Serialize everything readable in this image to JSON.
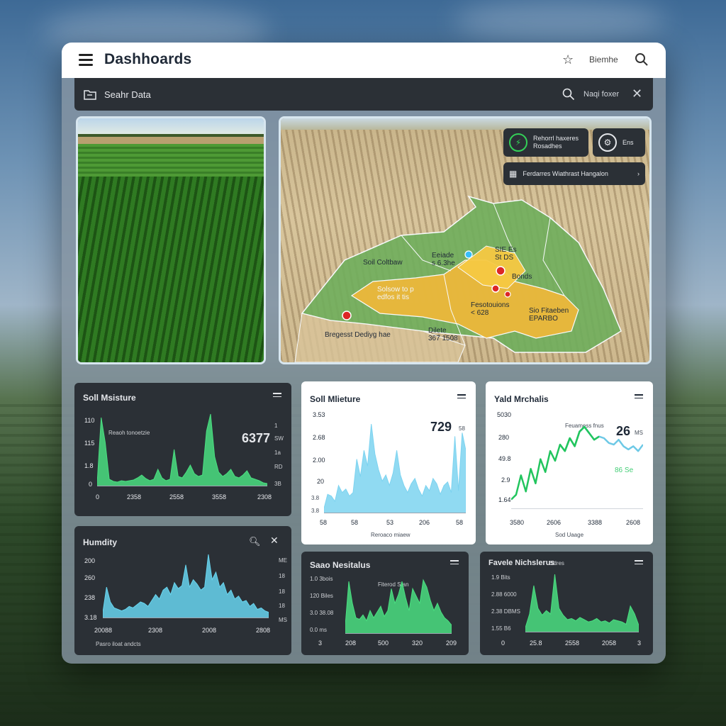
{
  "window": {
    "title": "Dashhoards"
  },
  "header": {
    "user_label": "Biemhe"
  },
  "search": {
    "placeholder": "Seahr Data",
    "filter_label": "Naqi foxer"
  },
  "map": {
    "badge_a": "Rehorrl haxeres\nRosadhes",
    "badge_b": "Ens",
    "badge_c": "Ferdarres Wiathrast Hangalon",
    "labels": {
      "soil": "Soil Coltbaw",
      "eod": "Eeiade\ns 6.3he",
      "selow": "Solsow to p\nedfos it tis",
      "sie": "SIE Es\nSt DS",
      "bondse": "Bonds",
      "fesot": "Fesotouions\n< 628",
      "sio": "Sio Fitaeben\nEPARBO",
      "breggest": "Bregesst Dediyg hae",
      "dilete": "Dilete\n367 1508"
    }
  },
  "cards": {
    "soil_dark": {
      "title": "Soll Msisture",
      "value": "6377",
      "note": "Reaoh tonoetzie",
      "y_ticks": [
        "110",
        "115",
        "1.8",
        "0"
      ],
      "x_ticks": [
        "0",
        "2358",
        "2558",
        "3558",
        "2308"
      ],
      "right_ticks": [
        "1",
        "SW",
        "1a",
        "RD",
        "3B"
      ]
    },
    "soil_light": {
      "title": "Soll Mlieture",
      "value": "729",
      "unit": "58",
      "y_ticks": [
        "3.53",
        "2.68",
        "2.00",
        "20",
        "58"
      ],
      "x_ticks": [
        "58",
        "53",
        "206",
        "58"
      ],
      "left_ticks": [
        "3.8",
        "3.8"
      ],
      "footer": "Reroaco miaew"
    },
    "yield": {
      "title": "Yald Mrchalis",
      "value": "26",
      "unit": "MS",
      "note": "Feuamess fnus",
      "badge": "86 Se",
      "y_ticks": [
        "5030",
        "280",
        "49.8",
        "2.9",
        "1.64"
      ],
      "x_ticks": [
        "3580",
        "2606",
        "3388",
        "2608"
      ],
      "footer": "Sod Uaage"
    },
    "humidity": {
      "title": "Humdity",
      "y_ticks": [
        "200",
        "260",
        "238",
        "3.18"
      ],
      "x_ticks": [
        "20088",
        "2308",
        "2008",
        "2808"
      ],
      "right_ticks": [
        "ME",
        "18",
        "18",
        "18",
        "MS"
      ],
      "footer": "Pasro iloat andcts"
    },
    "soil_nutrients": {
      "title": "Saao Nesitalus",
      "note": "Fiterod Stan",
      "y_ticks": [
        "1.0 3bois",
        "120 Biles",
        "3.0 38.08",
        "0.0 ms"
      ],
      "x_ticks": [
        "3",
        "208",
        "500",
        "320",
        "209"
      ]
    },
    "farm": {
      "title": "Favele Nichslerus",
      "title_suffix": "Sdres",
      "y_ticks": [
        "1.9 Bits",
        "2.88 6000",
        "2.38 DBMS",
        "1.55 B6"
      ],
      "x_ticks": [
        "0",
        "25.8",
        "2558",
        "2058",
        "3"
      ]
    }
  },
  "chart_data": [
    {
      "type": "area",
      "title": "Soll Msisture",
      "color": "#4ade80",
      "values": [
        2,
        95,
        60,
        8,
        5,
        4,
        6,
        5,
        6,
        7,
        10,
        14,
        9,
        6,
        8,
        22,
        10,
        6,
        8,
        50,
        12,
        10,
        18,
        28,
        16,
        12,
        14,
        76,
        100,
        40,
        18,
        12,
        16,
        22,
        12,
        10,
        14,
        20,
        10,
        8,
        6,
        3,
        2
      ]
    },
    {
      "type": "area",
      "title": "Soll Mlieture",
      "color": "#7dd3f0",
      "values": [
        4,
        20,
        18,
        12,
        30,
        22,
        26,
        18,
        22,
        60,
        40,
        70,
        52,
        100,
        66,
        48,
        35,
        42,
        30,
        44,
        70,
        42,
        30,
        22,
        32,
        38,
        26,
        18,
        30,
        24,
        38,
        32,
        20,
        30,
        34,
        22,
        86,
        24,
        90,
        70
      ]
    },
    {
      "type": "line",
      "title": "Yald Mrchalis",
      "colors": [
        "#22c55e",
        "#6ec9e6"
      ],
      "values": [
        10,
        16,
        40,
        20,
        48,
        30,
        60,
        44,
        70,
        58,
        78,
        70,
        86,
        76,
        94,
        100,
        92,
        84,
        88,
        86,
        80,
        78,
        84,
        76,
        72,
        76,
        70,
        78
      ]
    },
    {
      "type": "area",
      "title": "Humdity",
      "color": "#67d4ee",
      "values": [
        6,
        40,
        20,
        12,
        10,
        8,
        10,
        14,
        12,
        16,
        20,
        18,
        14,
        22,
        30,
        24,
        36,
        40,
        30,
        46,
        38,
        42,
        70,
        40,
        50,
        44,
        36,
        40,
        84,
        50,
        60,
        40,
        46,
        30,
        36,
        24,
        28,
        20,
        22,
        14,
        18,
        10,
        12,
        8,
        6
      ]
    },
    {
      "type": "area",
      "title": "Saao Nesitalus",
      "color": "#4ade80",
      "values": [
        10,
        70,
        40,
        20,
        18,
        24,
        16,
        30,
        20,
        28,
        36,
        22,
        30,
        60,
        40,
        52,
        70,
        48,
        30,
        60,
        50,
        40,
        72,
        62,
        44,
        30,
        40,
        28,
        20,
        16,
        10
      ]
    },
    {
      "type": "area",
      "title": "Favele Nichslerus",
      "color": "#4ade80",
      "values": [
        6,
        30,
        80,
        40,
        28,
        36,
        30,
        100,
        40,
        28,
        20,
        22,
        18,
        24,
        20,
        16,
        18,
        22,
        16,
        18,
        14,
        20,
        18,
        16,
        12,
        44,
        30,
        10
      ]
    }
  ]
}
